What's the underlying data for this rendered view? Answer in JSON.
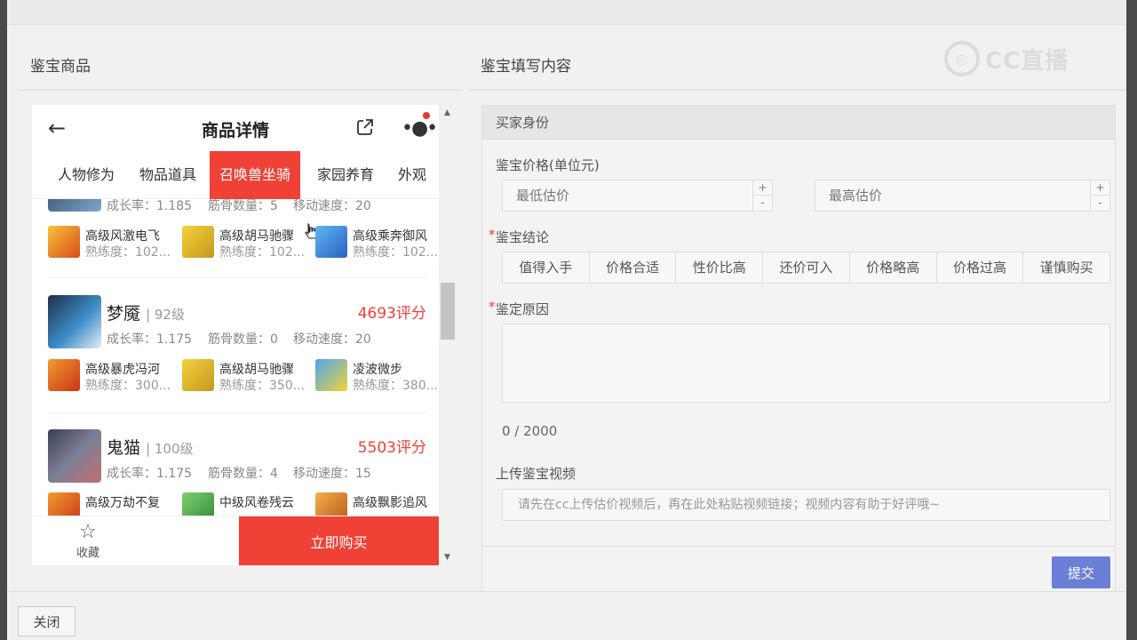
{
  "left_title": "鉴宝商品",
  "right_title": "鉴宝填写内容",
  "logo_text": "CC直播",
  "phone": {
    "title": "商品详情",
    "tabs": [
      "人物修为",
      "物品道具",
      "召唤兽坐骑",
      "家园养育",
      "外观"
    ],
    "active_tab": "召唤兽坐骑",
    "partial_meta": {
      "growth": "成长率：1.185",
      "bones": "筋骨数量：5",
      "speed": "移动速度：20"
    },
    "partial_skills": [
      {
        "name": "高级风激电飞",
        "level": "熟练度：102..."
      },
      {
        "name": "高级胡马驰骤",
        "level": "熟练度：102..."
      },
      {
        "name": "高级乘奔御风",
        "level": "熟练度：102..."
      }
    ],
    "pets": [
      {
        "name": "梦魇",
        "level": "| 92级",
        "score": "4693评分",
        "growth": "成长率：1.175",
        "bones": "筋骨数量：0",
        "speed": "移动速度：20",
        "skills": [
          {
            "name": "高级暴虎冯河",
            "level": "熟练度：300..."
          },
          {
            "name": "高级胡马驰骤",
            "level": "熟练度：350..."
          },
          {
            "name": "凌波微步",
            "level": "熟练度：380..."
          }
        ]
      },
      {
        "name": "鬼猫",
        "level": "| 100级",
        "score": "5503评分",
        "growth": "成长率：1.175",
        "bones": "筋骨数量：4",
        "speed": "移动速度：15",
        "skills": [
          {
            "name": "高级万劫不复"
          },
          {
            "name": "中级风卷残云"
          },
          {
            "name": "高级飘影追风"
          }
        ]
      }
    ],
    "fav_label": "收藏",
    "buy_label": "立即购买"
  },
  "form": {
    "section_title": "买家身份",
    "price_label": "鉴宝价格(单位元)",
    "min_placeholder": "最低估价",
    "max_placeholder": "最高估价",
    "stepper_plus": "+",
    "stepper_minus": "-",
    "conclusion_label": "鉴宝结论",
    "conclusions": [
      "值得入手",
      "价格合适",
      "性价比高",
      "还价可入",
      "价格略高",
      "价格过高",
      "谨慎购买"
    ],
    "reason_label": "鉴定原因",
    "counter": "0 / 2000",
    "video_label": "上传鉴宝视频",
    "video_placeholder": "请先在cc上传估价视频后，再在此处粘贴视频链接；视频内容有助于好评哦~",
    "required_mark": "*",
    "submit_label": "提交"
  },
  "close_label": "关闭",
  "colors": {
    "accent_red": "#ef4136",
    "submit_blue": "#6b7fd7"
  },
  "icons": {
    "back": "arrow-left",
    "share": "external-link",
    "more": "dots",
    "favorite": "star",
    "scroll_up": "triangle-up",
    "scroll_down": "triangle-down"
  }
}
